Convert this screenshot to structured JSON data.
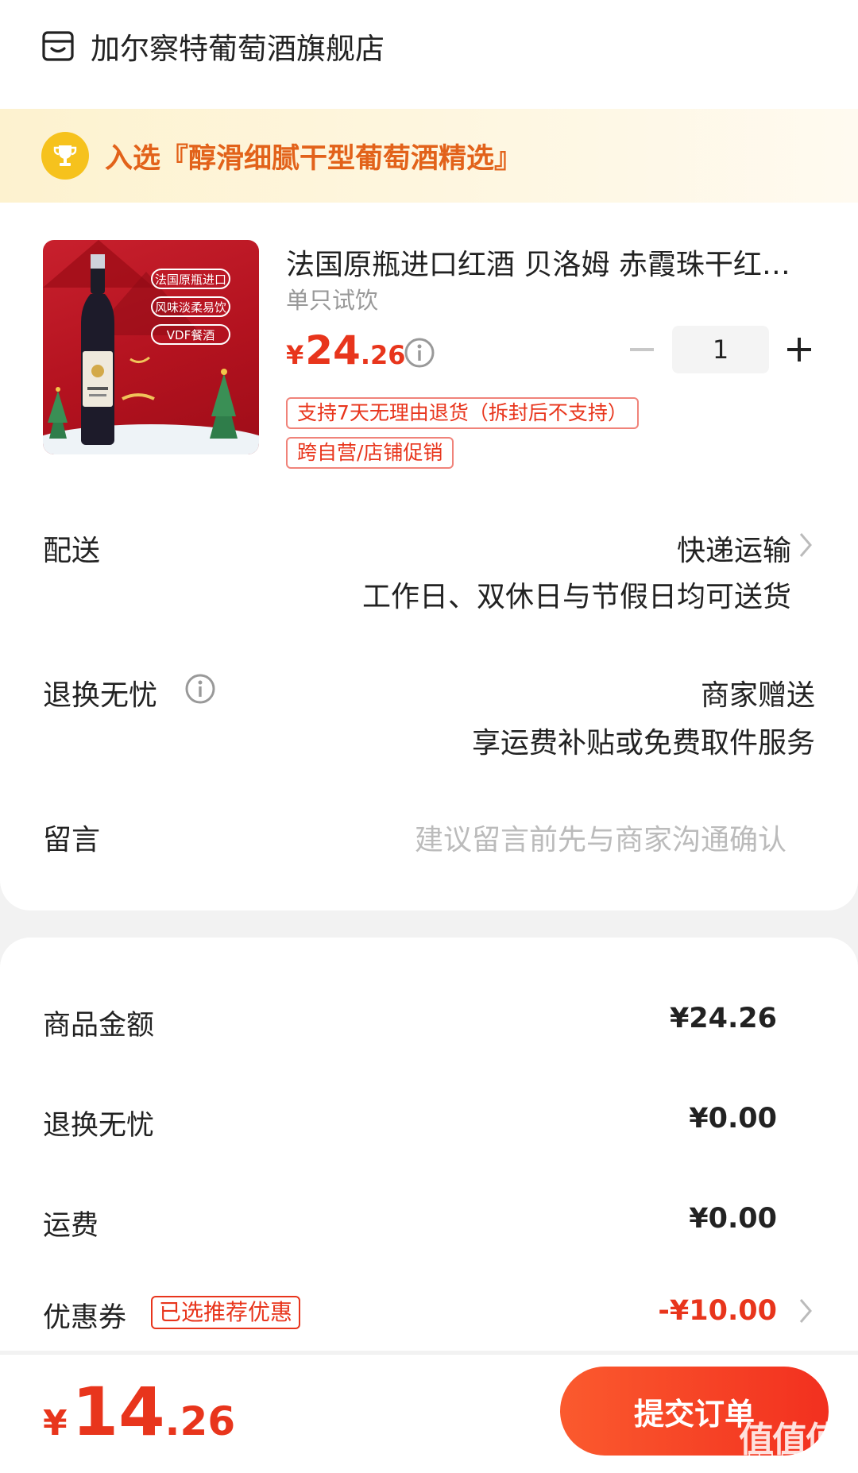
{
  "shop": {
    "name": "加尔察特葡萄酒旗舰店",
    "icon": "shop-icon"
  },
  "banner": {
    "text": "入选『醇滑细腻干型葡萄酒精选』",
    "icon": "trophy-icon"
  },
  "product": {
    "title": "法国原瓶进口红酒 贝洛姆 赤霞珠干红葡萄酒",
    "variant": "单只试饮",
    "price_currency": "¥",
    "price_int": "24",
    "price_dec": ".26",
    "quantity": "1",
    "image_labels": [
      "法国原瓶进口",
      "风味淡柔易饮",
      "VDF餐酒"
    ],
    "tags": [
      "支持7天无理由退货（拆封后不支持）",
      "跨自营/店铺促销"
    ]
  },
  "delivery": {
    "label": "配送",
    "method": "快递运输",
    "note": "工作日、双休日与节假日均可送货"
  },
  "returns": {
    "label": "退换无忧",
    "value": "商家赠送",
    "note": "享运费补贴或免费取件服务"
  },
  "message": {
    "label": "留言",
    "placeholder": "建议留言前先与商家沟通确认"
  },
  "summary": {
    "goods_label": "商品金额",
    "goods_value": "¥24.26",
    "returns_label": "退换无忧",
    "returns_value": "¥0.00",
    "shipping_label": "运费",
    "shipping_value": "¥0.00",
    "coupon_label": "优惠券",
    "coupon_tag": "已选推荐优惠",
    "coupon_value": "-¥10.00"
  },
  "footer": {
    "currency": "¥",
    "total_int": "14",
    "total_dec": ".26",
    "submit_label": "提交订单"
  },
  "watermark": {
    "text": "值值值",
    "url": "zhizhizhi.com"
  },
  "colors": {
    "accent": "#e8351c",
    "banner_text": "#e2621a",
    "trophy": "#f6c21d"
  }
}
